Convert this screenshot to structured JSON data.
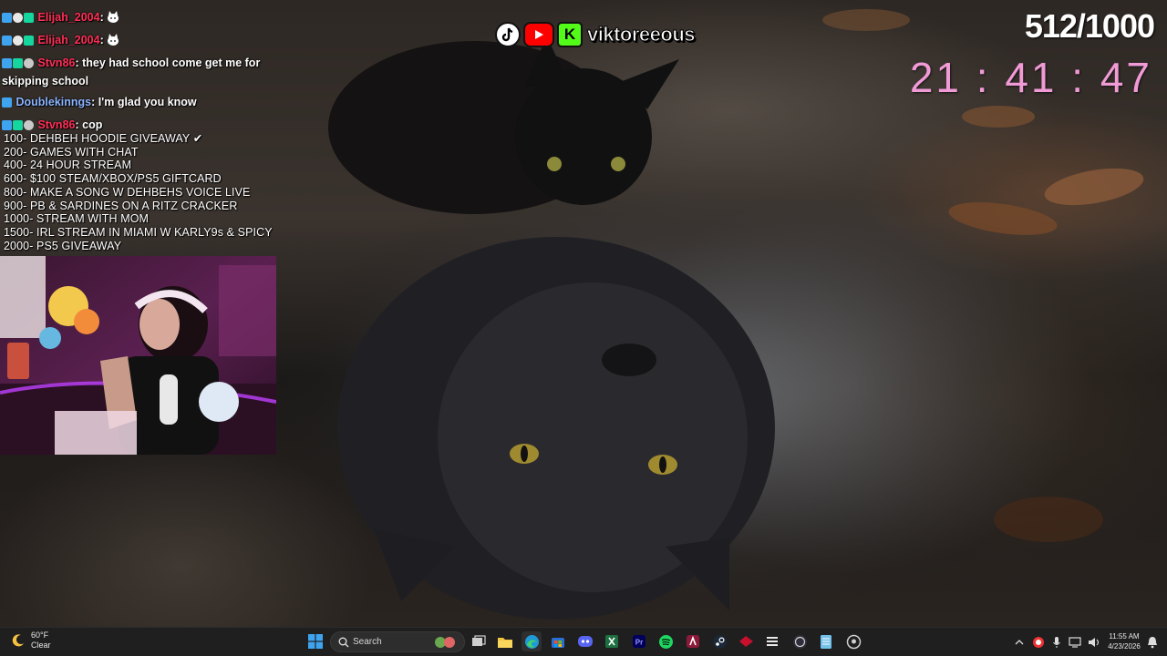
{
  "chat": {
    "messages": [
      {
        "username": "Elijah_2004",
        "text": ""
      },
      {
        "username": "Elijah_2004",
        "text": ""
      },
      {
        "username": "Stvn86",
        "text": "they had school come get me for skipping school"
      },
      {
        "username": "Doublekinngs",
        "text": "I'm glad you know"
      },
      {
        "username": "Stvn86",
        "text": "cop"
      }
    ]
  },
  "goals": [
    "100- DEHBEH HOODIE GIVEAWAY ✔",
    "200- GAMES WITH CHAT",
    "400- 24 HOUR STREAM",
    "600- $100 STEAM/XBOX/PS5 GIFTCARD",
    "800- MAKE A SONG W DEHBEHS VOICE LIVE",
    "900- PB & SARDINES ON A RITZ CRACKER",
    "1000- STREAM WITH MOM",
    "1500- IRL STREAM IN MIAMI W KARLY9s & SPICY",
    "2000- PS5 GIVEAWAY"
  ],
  "socials": {
    "handle": "viktoreeous",
    "icons": [
      "tiktok-icon",
      "youtube-icon",
      "kick-icon"
    ],
    "kick_letter": "K"
  },
  "counter": "512/1000",
  "clock": "21 : 41 : 47",
  "colors": {
    "username_red": "#ff2f56",
    "username_blue": "#8ab4ff",
    "clock_pink": "#f09ad6",
    "taskbar_bg": "#1f1f1f"
  },
  "taskbar": {
    "weather_temp": "60°F",
    "weather_cond": "Clear",
    "search_label": "Search",
    "time": "11:55 AM",
    "date": "4/23/2026"
  }
}
